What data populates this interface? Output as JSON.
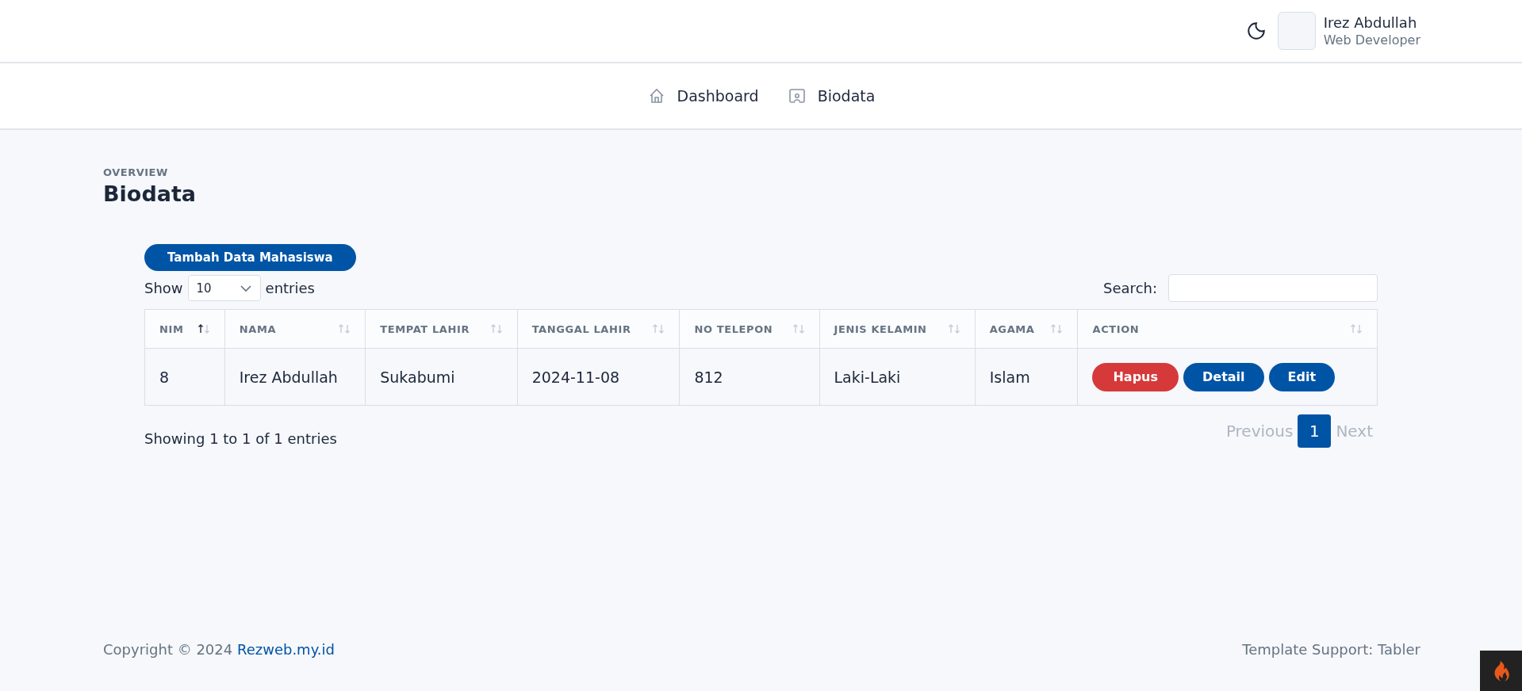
{
  "header": {
    "user": {
      "name": "Irez Abdullah",
      "role": "Web Developer"
    }
  },
  "nav": [
    {
      "label": "Dashboard",
      "kind": "home"
    },
    {
      "label": "Biodata",
      "kind": "user"
    }
  ],
  "page": {
    "pretitle": "OVERVIEW",
    "title": "Biodata"
  },
  "add_button": "Tambah Data Mahasiswa",
  "length": {
    "before": "Show",
    "value": "10",
    "after": "entries"
  },
  "search": {
    "label": "Search:"
  },
  "table": {
    "columns": [
      {
        "label": "NIM",
        "sorted": true
      },
      {
        "label": "NAMA",
        "sorted": false
      },
      {
        "label": "TEMPAT LAHIR",
        "sorted": false
      },
      {
        "label": "TANGGAL LAHIR",
        "sorted": false
      },
      {
        "label": "NO TELEPON",
        "sorted": false
      },
      {
        "label": "JENIS KELAMIN",
        "sorted": false
      },
      {
        "label": "AGAMA",
        "sorted": false
      },
      {
        "label": "ACTION",
        "sorted": false
      }
    ],
    "rows": [
      {
        "cells": [
          "8",
          "Irez Abdullah",
          "Sukabumi",
          "2024-11-08",
          "812",
          "Laki-Laki",
          "Islam"
        ],
        "actions": [
          {
            "label": "Hapus",
            "kind": "danger"
          },
          {
            "label": "Detail",
            "kind": "primary"
          },
          {
            "label": "Edit",
            "kind": "primary"
          }
        ]
      }
    ]
  },
  "info": "Showing 1 to 1 of 1 entries",
  "pagination": {
    "previous": {
      "label": "Previous",
      "disabled": true
    },
    "pages": [
      {
        "label": "1",
        "selected": true
      }
    ],
    "next": {
      "label": "Next",
      "disabled": true
    }
  },
  "footer": {
    "copyright": "Copyright © 2024",
    "link": "Rezweb.my.id",
    "support": "Template Support: Tabler"
  }
}
